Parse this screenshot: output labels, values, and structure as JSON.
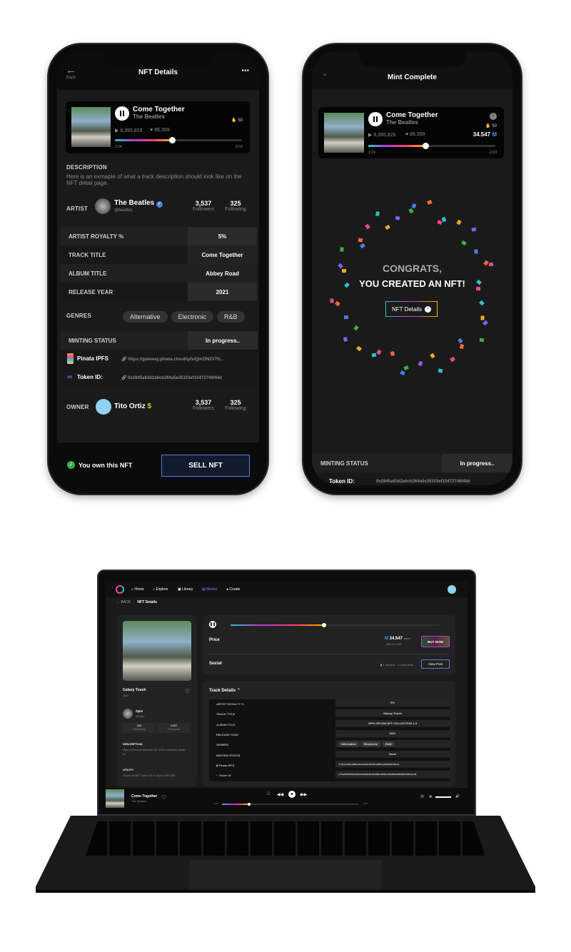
{
  "track": {
    "title": "Come Together",
    "artist": "The Beatles",
    "plays": "▶ 8,395,826",
    "likes": "♥ 86,359",
    "edition": "50",
    "elapsed": "1:24",
    "remaining": "-2:03",
    "progress": 0.45
  },
  "left_phone": {
    "back_label": "Back",
    "title": "NFT Details",
    "more": "•••",
    "description_label": "DESCRIPTION",
    "description": "Here is an exmaple of what a track description should look like on the NFT detail page.",
    "artist_label": "ARTIST",
    "artist_name": "The Beatles",
    "artist_handle": "@beatles",
    "followers": "3,537",
    "followers_label": "Followers",
    "following": "325",
    "following_label": "Following",
    "rows": [
      {
        "k": "ARTIST ROYALTY %",
        "v": "5%"
      },
      {
        "k": "TRACK TITLE",
        "v": "Come Together"
      },
      {
        "k": "ALBUM TITLE",
        "v": "Abbey Road"
      },
      {
        "k": "RELEASE YEAR",
        "v": "2021"
      }
    ],
    "genres_label": "GENRES",
    "genres": [
      "Alternative",
      "Electronic",
      "R&B"
    ],
    "minting_label": "MINTING STATUS",
    "minting_value": "In progress..",
    "pinata_label": "Pinata IPFS",
    "pinata_value": "https://gateway.pinata.cloud/ipfs/QmZfN2V7G...",
    "token_label": "Token ID:",
    "token_value": "0x2845a83d2a6cb264a5e35103ef10472746f44d",
    "owner_label": "OWNER",
    "owner_name": "Tito Ortiz",
    "owner_followers": "3,537",
    "owner_following": "325",
    "own_label": "You own this NFT",
    "sell_label": "SELL NFT"
  },
  "right_phone": {
    "title": "Mint Complete",
    "price": "34.547",
    "congrats": "CONGRATS,",
    "created": "YOU CREATED AN NFT!",
    "nft_details_btn": "NFT Details",
    "minting_label": "MINTING STATUS",
    "minting_value": "In progress..",
    "token_label": "Token ID:",
    "token_value": "0x2845a83d2a6cb264a5e35103ef10472746f44d"
  },
  "laptop": {
    "nav": [
      "Home",
      "Explore",
      "Library",
      "Market",
      "Create"
    ],
    "back": "BACK",
    "page_title": "NFT Details",
    "track_name": "Galaxy Touch",
    "track_artist": "Opio",
    "artist_name": "Opio",
    "artist_handle": "@Opio",
    "following": "325",
    "following_label": "Following",
    "followers": "3,537",
    "followers_label": "Followers",
    "description_label": "DESCRIPTION",
    "description": "Opio of Soul of Mischief SP-1200 collection issue #2",
    "utility_label": "UTILITY",
    "utility": "Owner of NFT issue #2 of Opio's SP1200",
    "elapsed": "1:24",
    "remaining": "-2:03",
    "price_label": "Price",
    "price": "34.547",
    "price_unit": "MATIC",
    "price_usd": "$35.37 USD",
    "buy_label": "BUY NOW",
    "social_label": "Social",
    "reactions": "1 reaction",
    "comments": "0 comments",
    "view_post": "View Post",
    "track_details": "Track Details",
    "rows": [
      {
        "k": "ARTIST ROYALTY %",
        "v": "5%"
      },
      {
        "k": "TRACK TITLE",
        "v": "Galaxy Touch"
      },
      {
        "k": "ALBUM TITLE",
        "v": "OPIO SP1200 NFT COLLECTION 1-3"
      },
      {
        "k": "RELEASE YEAR",
        "v": "2021"
      }
    ],
    "genres_label": "GENRES",
    "genres": [
      "Alternative",
      "Electronic",
      "R&B"
    ],
    "minting_label": "MINTING STATUS",
    "minting_value": "Done",
    "pinata_label": "Pinata IPFS",
    "pinata_value": "QmUnWpryM8CeKbeB4eSeGDHSnJNP9sg2kBSNnc6kntc",
    "token_label": "Token ID",
    "token_value": "0x9708a7f67fa2812e3b329e2ba2b408e10082e41bb8b9a96f2b6d47f627ecb8",
    "player_title": "Come Together",
    "player_artist": "The Beatles",
    "player_elapsed": "1:24",
    "player_remaining": "-2:03"
  },
  "colors": {
    "accent_blue": "#3b82f6",
    "verified": "#4a7fe0",
    "success": "#3cb043",
    "gold": "#e3c01c",
    "sell_border": "#5a7be0"
  }
}
